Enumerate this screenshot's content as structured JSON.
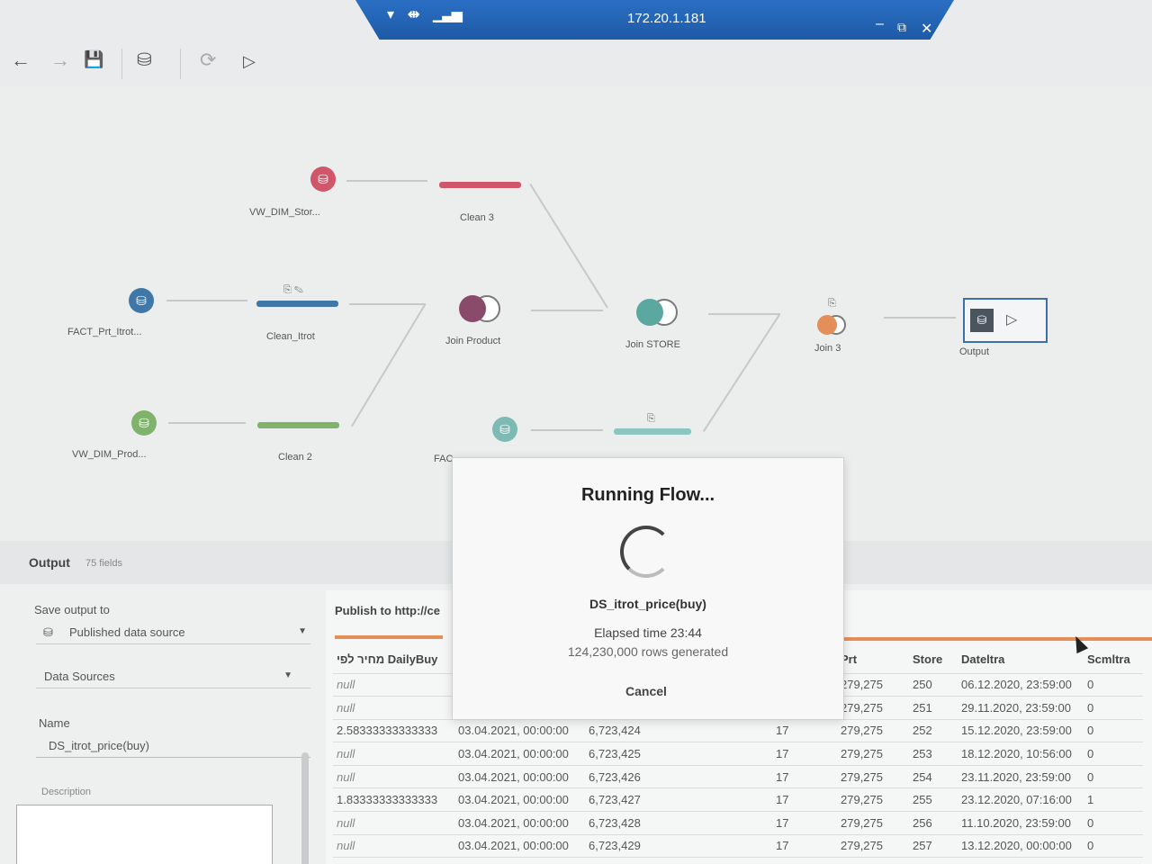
{
  "remote_bar": {
    "host": "172.20.1.181",
    "minimize": "–",
    "restore": "⧉",
    "close": "✕"
  },
  "toolbar": {
    "back": "←",
    "forward": "→",
    "save": "💾",
    "data": "⛁",
    "refresh": "⟳",
    "run": "▷"
  },
  "nodes": {
    "vw_dim_stor": "VW_DIM_Stor...",
    "clean3": "Clean 3",
    "fact_prt": "FACT_Prt_Itrot...",
    "clean_itrot": "Clean_Itrot",
    "join_product": "Join Product",
    "join_store": "Join STORE",
    "join3": "Join 3",
    "output": "Output",
    "vw_dim_prod": "VW_DIM_Prod...",
    "clean2": "Clean 2",
    "fac": "FAC"
  },
  "output_panel": {
    "title": "Output",
    "fields": "75 fields",
    "save_output_label": "Save output to",
    "save_output_value": "Published data source",
    "data_sources": "Data Sources",
    "name_label": "Name",
    "name_value": "DS_itrot_price(buy)",
    "description_label": "Description",
    "publish_label": "Publish to http://ce"
  },
  "grid": {
    "left_header": "מחיר לפי DailyBuy",
    "right_headers": [
      "Prt",
      "Store",
      "Dateltra",
      "Scmltra"
    ],
    "rows": [
      {
        "a": "null",
        "b": "",
        "c": "",
        "d": "",
        "prt": "279,275",
        "store": "250",
        "date": "06.12.2020, 23:59:00",
        "s": "0"
      },
      {
        "a": "null",
        "b": "",
        "c": "",
        "d": "",
        "prt": "279,275",
        "store": "251",
        "date": "29.11.2020, 23:59:00",
        "s": "0"
      },
      {
        "a": "2.58333333333333",
        "b": "03.04.2021, 00:00:00",
        "c": "6,723,424",
        "d": "17",
        "prt": "279,275",
        "store": "252",
        "date": "15.12.2020, 23:59:00",
        "s": "0"
      },
      {
        "a": "null",
        "b": "03.04.2021, 00:00:00",
        "c": "6,723,425",
        "d": "17",
        "prt": "279,275",
        "store": "253",
        "date": "18.12.2020, 10:56:00",
        "s": "0"
      },
      {
        "a": "null",
        "b": "03.04.2021, 00:00:00",
        "c": "6,723,426",
        "d": "17",
        "prt": "279,275",
        "store": "254",
        "date": "23.11.2020, 23:59:00",
        "s": "0"
      },
      {
        "a": "1.83333333333333",
        "b": "03.04.2021, 00:00:00",
        "c": "6,723,427",
        "d": "17",
        "prt": "279,275",
        "store": "255",
        "date": "23.12.2020, 07:16:00",
        "s": "1"
      },
      {
        "a": "null",
        "b": "03.04.2021, 00:00:00",
        "c": "6,723,428",
        "d": "17",
        "prt": "279,275",
        "store": "256",
        "date": "11.10.2020, 23:59:00",
        "s": "0"
      },
      {
        "a": "null",
        "b": "03.04.2021, 00:00:00",
        "c": "6,723,429",
        "d": "17",
        "prt": "279,275",
        "store": "257",
        "date": "13.12.2020, 00:00:00",
        "s": "0"
      }
    ]
  },
  "modal": {
    "title": "Running Flow...",
    "datasource": "DS_itrot_price(buy)",
    "elapsed": "Elapsed time 23:44",
    "rows": "124,230,000 rows generated",
    "cancel": "Cancel"
  },
  "colors": {
    "red": "#d0566a",
    "blue": "#3f78a8",
    "green": "#7fb26a",
    "teal": "#5aa8a0",
    "orange": "#e48e5a",
    "purple": "#8a4a6a"
  }
}
